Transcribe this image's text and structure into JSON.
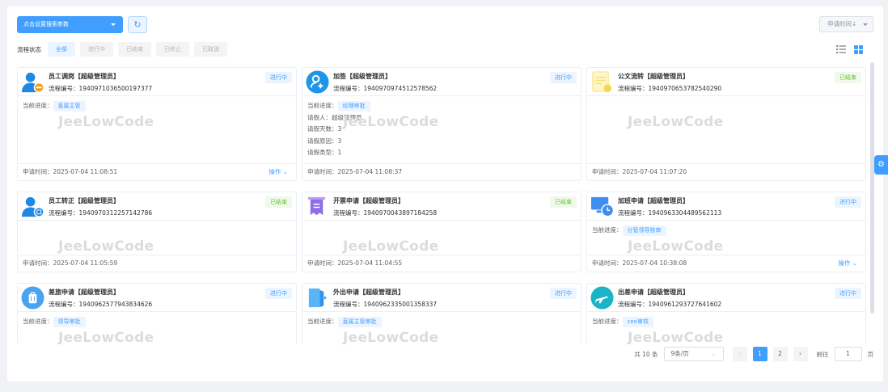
{
  "toolbar": {
    "search_label": "点击设置搜索参数",
    "sort_label": "申请时间↓"
  },
  "filter": {
    "label": "流程状态",
    "options": [
      "全部",
      "进行中",
      "已结束",
      "已终止",
      "已取消"
    ],
    "active": "全部"
  },
  "labels": {
    "num": "流程编号：",
    "progress": "当前进度：",
    "time": "申请时间：",
    "op": "操作",
    "watermark": "JeeLowCode"
  },
  "colors": {
    "primary": "#409eff",
    "success": "#67c23a"
  },
  "cards": [
    {
      "title": "员工调岗【超级管理员】",
      "num": "1940971036500197377",
      "status": "进行中",
      "progress": "直属主管",
      "fields": [],
      "time": "2025-07-04 11:08:51",
      "op": true,
      "icon": "user-transfer-icon"
    },
    {
      "title": "加签【超级管理员】",
      "num": "1940970974512578562",
      "status": "进行中",
      "progress": "经理审批",
      "fields": [
        "请假人：超级管理员",
        "请假天数：3",
        "请假原因：3",
        "请假类型：1"
      ],
      "time": "2025-07-04 11:08:37",
      "op": false,
      "icon": "add-user-icon"
    },
    {
      "title": "公文流转【超级管理员】",
      "num": "1940970653782540290",
      "status": "已结束",
      "progress": "",
      "fields": [],
      "time": "2025-07-04 11:07:20",
      "op": false,
      "icon": "document-icon"
    },
    {
      "title": "员工转正【超级管理员】",
      "num": "1940970312257142786",
      "status": "已结束",
      "progress": "",
      "fields": [],
      "time": "2025-07-04 11:05:59",
      "op": false,
      "icon": "user-regular-icon"
    },
    {
      "title": "开票申请【超级管理员】",
      "num": "1940970043897184258",
      "status": "已结束",
      "progress": "",
      "fields": [],
      "time": "2025-07-04 11:04:55",
      "op": false,
      "icon": "invoice-icon"
    },
    {
      "title": "加班申请【超级管理员】",
      "num": "1940963304489562113",
      "status": "进行中",
      "progress": "分管领导核审",
      "fields": [],
      "time": "2025-07-04 10:38:08",
      "op": true,
      "icon": "overtime-icon"
    },
    {
      "title": "差旅申请【超级管理员】",
      "num": "1940962577943834626",
      "status": "进行中",
      "progress": "领导审批",
      "fields": [],
      "time": "",
      "op": false,
      "icon": "luggage-icon"
    },
    {
      "title": "外出申请【超级管理员】",
      "num": "1940962335001358337",
      "status": "进行中",
      "progress": "直属主管审批",
      "fields": [],
      "time": "",
      "op": false,
      "icon": "exit-door-icon"
    },
    {
      "title": "出差申请【超级管理员】",
      "num": "1940961293727641602",
      "status": "进行中",
      "progress": "ceo审核",
      "fields": [],
      "time": "",
      "op": false,
      "icon": "plane-icon"
    }
  ],
  "pagination": {
    "total": "共 10 条",
    "page_size": "9条/页",
    "pages": [
      "1",
      "2"
    ],
    "current": "1",
    "goto_label": "前往",
    "goto_value": "1",
    "page_unit": "页"
  }
}
